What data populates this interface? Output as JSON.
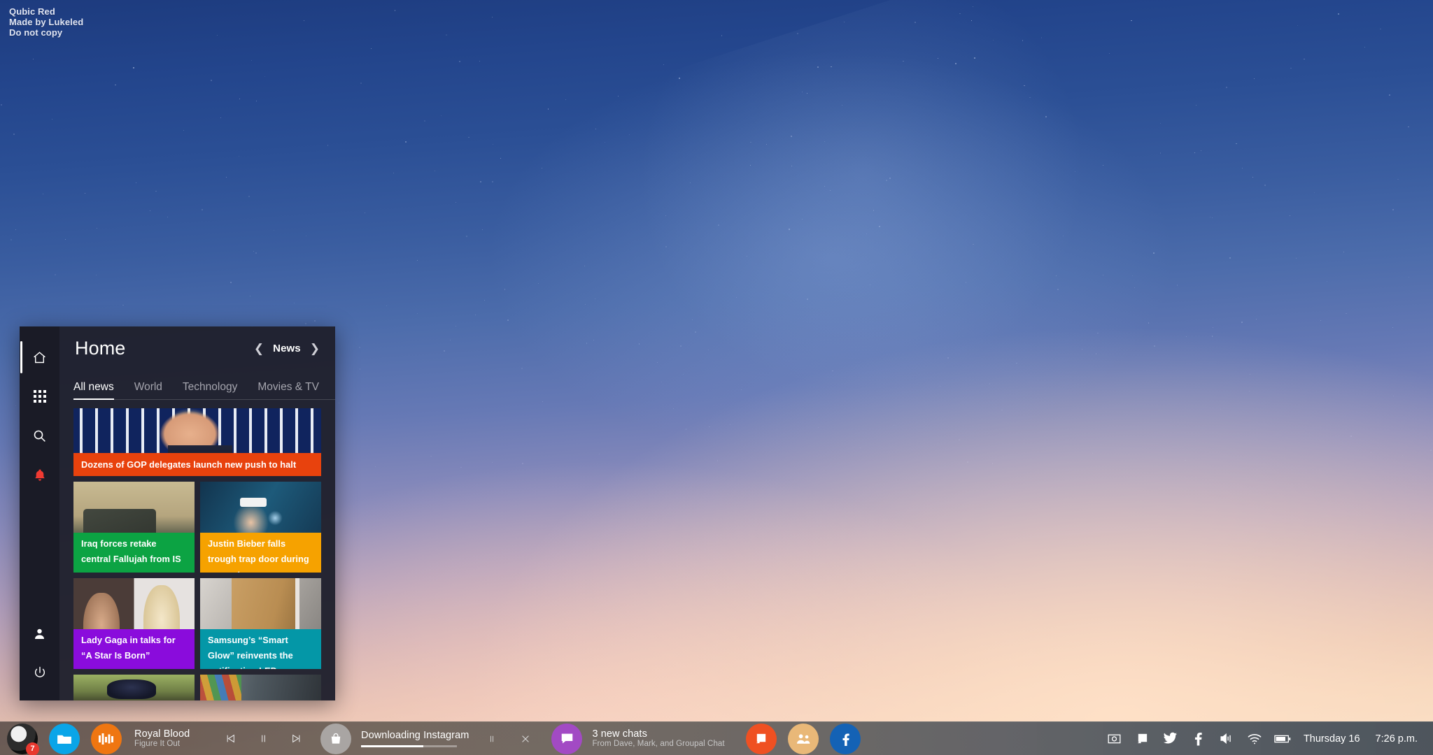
{
  "wallpaper": {
    "watermark_lines": [
      "Qubic Red",
      "Made by Lukeled",
      "Do not copy"
    ]
  },
  "start_panel": {
    "title": "Home",
    "section": {
      "prev_icon": "chevron-left-icon",
      "label": "News",
      "next_icon": "chevron-right-icon"
    },
    "rail": [
      {
        "icon": "home-icon",
        "name": "home",
        "selected": true
      },
      {
        "icon": "apps-grid-icon",
        "name": "all-apps",
        "selected": false
      },
      {
        "icon": "search-icon",
        "name": "search",
        "selected": false
      },
      {
        "icon": "bell-icon",
        "name": "notifications",
        "selected": false,
        "color": "#f03a32"
      },
      {
        "icon": "person-icon",
        "name": "account",
        "selected": false
      },
      {
        "icon": "power-icon",
        "name": "power",
        "selected": false
      }
    ],
    "tabs": [
      {
        "label": "All news",
        "active": true
      },
      {
        "label": "World",
        "active": false
      },
      {
        "label": "Technology",
        "active": false
      },
      {
        "label": "Movies & TV",
        "active": false
      }
    ],
    "tabs_more_icon": "more-vertical-icon",
    "tiles": [
      {
        "headline": "Dozens of GOP delegates launch new push to halt Trump",
        "color": "#e8420d",
        "size": "wide",
        "art": "th-trump"
      },
      {
        "headline": "Iraq forces retake central Fallujah from IS",
        "color": "#0ca343",
        "size": "half",
        "art": "th-iraq"
      },
      {
        "headline": "Justin Bieber falls trough trap door during concert",
        "color": "#f6a200",
        "size": "half",
        "art": "th-bieber"
      },
      {
        "headline": "Lady Gaga in talks for “A Star Is Born”",
        "color": "#8a0cdc",
        "size": "half",
        "art": "th-gaga"
      },
      {
        "headline": "Samsung’s “Smart Glow” reinvents the notification LED",
        "color": "#0497a7",
        "size": "half",
        "art": "th-samsung"
      },
      {
        "headline": "",
        "color": "#3f7d23",
        "size": "half",
        "art": "th-base"
      },
      {
        "headline": "",
        "color": "#2b4c66",
        "size": "half",
        "art": "th-car"
      }
    ]
  },
  "taskbar": {
    "start": {
      "name": "start-avatar",
      "badge": "7"
    },
    "pinned": [
      {
        "name": "file-explorer",
        "icon": "folder-icon",
        "color": "#0aa5e8",
        "running": true
      },
      {
        "name": "groove-music",
        "icon": "equalizer-icon",
        "color": "#ef7611",
        "running": true
      }
    ],
    "now_playing": {
      "title": "Royal Blood",
      "subtitle": "Figure It Out",
      "prev_icon": "previous-track-icon",
      "play_icon": "pause-icon",
      "next_icon": "next-track-icon"
    },
    "download": {
      "app_icon": "store-bag-icon",
      "title": "Downloading Instagram",
      "progress_percent": 65,
      "pause_icon": "pause-icon",
      "cancel_icon": "close-icon"
    },
    "messages": {
      "app_icon": "messaging-icon",
      "color": "#a24ac4",
      "title": "3 new chats",
      "subtitle": "From Dave, Mark, and Groupal Chat"
    },
    "more_pinned": [
      {
        "name": "powerpoint",
        "icon": "powerpoint-icon",
        "color": "#ef5022",
        "running": true
      },
      {
        "name": "people",
        "icon": "people-icon",
        "color": "#e9b878",
        "running": false
      },
      {
        "name": "facebook-app",
        "icon": "facebook-icon",
        "color": "#1462b5",
        "running": false
      }
    ],
    "tray": [
      {
        "name": "camera",
        "icon": "camera-icon"
      },
      {
        "name": "project",
        "icon": "project-screen-icon"
      },
      {
        "name": "twitter",
        "icon": "twitter-icon"
      },
      {
        "name": "facebook",
        "icon": "facebook-letter-icon"
      },
      {
        "name": "volume",
        "icon": "volume-icon"
      },
      {
        "name": "wifi",
        "icon": "wifi-icon"
      },
      {
        "name": "battery",
        "icon": "battery-icon"
      }
    ],
    "clock": {
      "date": "Thursday 16",
      "time": "7:26 p.m."
    }
  }
}
